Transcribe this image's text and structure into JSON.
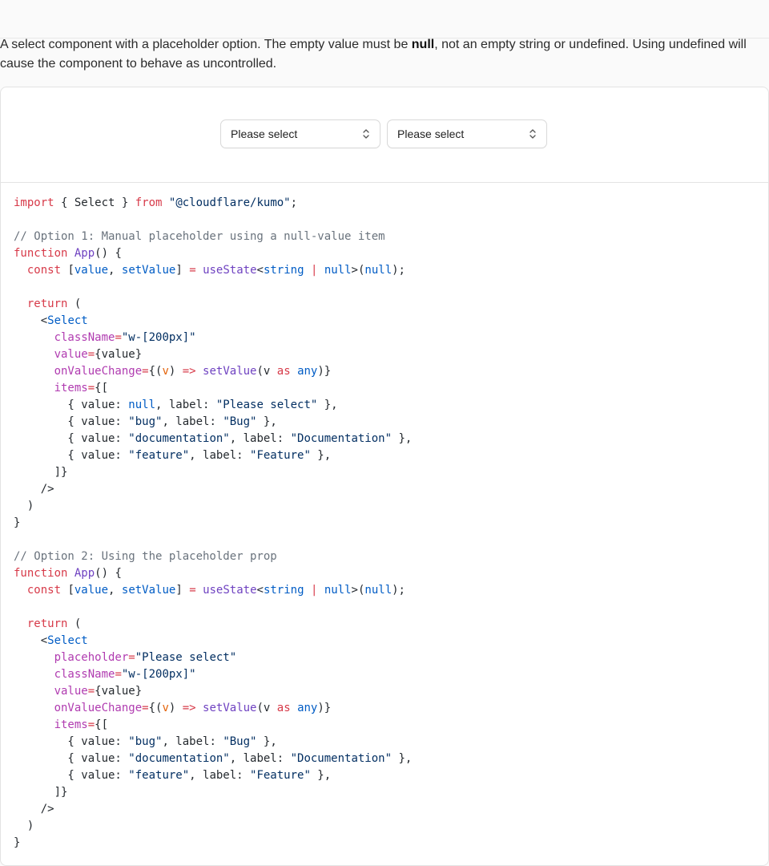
{
  "description": {
    "before": "A select component with a placeholder option. The empty value must be ",
    "bold": "null",
    "after": ", not an empty string or undefined. Using undefined will cause the component to behave as uncontrolled."
  },
  "preview": {
    "select1_value": "Please select",
    "select2_value": "Please select"
  },
  "code_lines": [
    [
      {
        "t": "import",
        "c": "kw"
      },
      {
        "t": " { Select } ",
        "c": "tx"
      },
      {
        "t": "from",
        "c": "kw"
      },
      {
        "t": " ",
        "c": "tx"
      },
      {
        "t": "\"@cloudflare/kumo\"",
        "c": "str"
      },
      {
        "t": ";",
        "c": "tx"
      }
    ],
    [],
    [
      {
        "t": "// Option 1: Manual placeholder using a null-value item",
        "c": "cm"
      }
    ],
    [
      {
        "t": "function",
        "c": "kw"
      },
      {
        "t": " ",
        "c": "tx"
      },
      {
        "t": "App",
        "c": "fn"
      },
      {
        "t": "() {",
        "c": "tx"
      }
    ],
    [
      {
        "t": "  const",
        "c": "kw"
      },
      {
        "t": " [",
        "c": "tx"
      },
      {
        "t": "value",
        "c": "bl"
      },
      {
        "t": ", ",
        "c": "tx"
      },
      {
        "t": "setValue",
        "c": "bl"
      },
      {
        "t": "] ",
        "c": "tx"
      },
      {
        "t": "=",
        "c": "kw"
      },
      {
        "t": " ",
        "c": "tx"
      },
      {
        "t": "useState",
        "c": "fn"
      },
      {
        "t": "<",
        "c": "tx"
      },
      {
        "t": "string",
        "c": "bl"
      },
      {
        "t": " ",
        "c": "tx"
      },
      {
        "t": "|",
        "c": "kw"
      },
      {
        "t": " ",
        "c": "tx"
      },
      {
        "t": "null",
        "c": "bl"
      },
      {
        "t": ">(",
        "c": "tx"
      },
      {
        "t": "null",
        "c": "bl"
      },
      {
        "t": ");",
        "c": "tx"
      }
    ],
    [],
    [
      {
        "t": "  return",
        "c": "kw"
      },
      {
        "t": " (",
        "c": "tx"
      }
    ],
    [
      {
        "t": "    <",
        "c": "tx"
      },
      {
        "t": "Select",
        "c": "bl"
      }
    ],
    [
      {
        "t": "      className",
        "c": "at"
      },
      {
        "t": "=",
        "c": "kw"
      },
      {
        "t": "\"w-[200px]\"",
        "c": "str"
      }
    ],
    [
      {
        "t": "      value",
        "c": "at"
      },
      {
        "t": "=",
        "c": "kw"
      },
      {
        "t": "{value}",
        "c": "tx"
      }
    ],
    [
      {
        "t": "      onValueChange",
        "c": "at"
      },
      {
        "t": "=",
        "c": "kw"
      },
      {
        "t": "{(",
        "c": "tx"
      },
      {
        "t": "v",
        "c": "or"
      },
      {
        "t": ") ",
        "c": "tx"
      },
      {
        "t": "=>",
        "c": "kw"
      },
      {
        "t": " ",
        "c": "tx"
      },
      {
        "t": "setValue",
        "c": "fn"
      },
      {
        "t": "(v ",
        "c": "tx"
      },
      {
        "t": "as",
        "c": "kw"
      },
      {
        "t": " ",
        "c": "tx"
      },
      {
        "t": "any",
        "c": "bl"
      },
      {
        "t": ")}",
        "c": "tx"
      }
    ],
    [
      {
        "t": "      items",
        "c": "at"
      },
      {
        "t": "=",
        "c": "kw"
      },
      {
        "t": "{[",
        "c": "tx"
      }
    ],
    [
      {
        "t": "        { value: ",
        "c": "tx"
      },
      {
        "t": "null",
        "c": "bl"
      },
      {
        "t": ", label: ",
        "c": "tx"
      },
      {
        "t": "\"Please select\"",
        "c": "str"
      },
      {
        "t": " },",
        "c": "tx"
      }
    ],
    [
      {
        "t": "        { value: ",
        "c": "tx"
      },
      {
        "t": "\"bug\"",
        "c": "str"
      },
      {
        "t": ", label: ",
        "c": "tx"
      },
      {
        "t": "\"Bug\"",
        "c": "str"
      },
      {
        "t": " },",
        "c": "tx"
      }
    ],
    [
      {
        "t": "        { value: ",
        "c": "tx"
      },
      {
        "t": "\"documentation\"",
        "c": "str"
      },
      {
        "t": ", label: ",
        "c": "tx"
      },
      {
        "t": "\"Documentation\"",
        "c": "str"
      },
      {
        "t": " },",
        "c": "tx"
      }
    ],
    [
      {
        "t": "        { value: ",
        "c": "tx"
      },
      {
        "t": "\"feature\"",
        "c": "str"
      },
      {
        "t": ", label: ",
        "c": "tx"
      },
      {
        "t": "\"Feature\"",
        "c": "str"
      },
      {
        "t": " },",
        "c": "tx"
      }
    ],
    [
      {
        "t": "      ]}",
        "c": "tx"
      }
    ],
    [
      {
        "t": "    />",
        "c": "tx"
      }
    ],
    [
      {
        "t": "  )",
        "c": "tx"
      }
    ],
    [
      {
        "t": "}",
        "c": "tx"
      }
    ],
    [],
    [
      {
        "t": "// Option 2: Using the placeholder prop",
        "c": "cm"
      }
    ],
    [
      {
        "t": "function",
        "c": "kw"
      },
      {
        "t": " ",
        "c": "tx"
      },
      {
        "t": "App",
        "c": "fn"
      },
      {
        "t": "() {",
        "c": "tx"
      }
    ],
    [
      {
        "t": "  const",
        "c": "kw"
      },
      {
        "t": " [",
        "c": "tx"
      },
      {
        "t": "value",
        "c": "bl"
      },
      {
        "t": ", ",
        "c": "tx"
      },
      {
        "t": "setValue",
        "c": "bl"
      },
      {
        "t": "] ",
        "c": "tx"
      },
      {
        "t": "=",
        "c": "kw"
      },
      {
        "t": " ",
        "c": "tx"
      },
      {
        "t": "useState",
        "c": "fn"
      },
      {
        "t": "<",
        "c": "tx"
      },
      {
        "t": "string",
        "c": "bl"
      },
      {
        "t": " ",
        "c": "tx"
      },
      {
        "t": "|",
        "c": "kw"
      },
      {
        "t": " ",
        "c": "tx"
      },
      {
        "t": "null",
        "c": "bl"
      },
      {
        "t": ">(",
        "c": "tx"
      },
      {
        "t": "null",
        "c": "bl"
      },
      {
        "t": ");",
        "c": "tx"
      }
    ],
    [],
    [
      {
        "t": "  return",
        "c": "kw"
      },
      {
        "t": " (",
        "c": "tx"
      }
    ],
    [
      {
        "t": "    <",
        "c": "tx"
      },
      {
        "t": "Select",
        "c": "bl"
      }
    ],
    [
      {
        "t": "      placeholder",
        "c": "at"
      },
      {
        "t": "=",
        "c": "kw"
      },
      {
        "t": "\"Please select\"",
        "c": "str"
      }
    ],
    [
      {
        "t": "      className",
        "c": "at"
      },
      {
        "t": "=",
        "c": "kw"
      },
      {
        "t": "\"w-[200px]\"",
        "c": "str"
      }
    ],
    [
      {
        "t": "      value",
        "c": "at"
      },
      {
        "t": "=",
        "c": "kw"
      },
      {
        "t": "{value}",
        "c": "tx"
      }
    ],
    [
      {
        "t": "      onValueChange",
        "c": "at"
      },
      {
        "t": "=",
        "c": "kw"
      },
      {
        "t": "{(",
        "c": "tx"
      },
      {
        "t": "v",
        "c": "or"
      },
      {
        "t": ") ",
        "c": "tx"
      },
      {
        "t": "=>",
        "c": "kw"
      },
      {
        "t": " ",
        "c": "tx"
      },
      {
        "t": "setValue",
        "c": "fn"
      },
      {
        "t": "(v ",
        "c": "tx"
      },
      {
        "t": "as",
        "c": "kw"
      },
      {
        "t": " ",
        "c": "tx"
      },
      {
        "t": "any",
        "c": "bl"
      },
      {
        "t": ")}",
        "c": "tx"
      }
    ],
    [
      {
        "t": "      items",
        "c": "at"
      },
      {
        "t": "=",
        "c": "kw"
      },
      {
        "t": "{[",
        "c": "tx"
      }
    ],
    [
      {
        "t": "        { value: ",
        "c": "tx"
      },
      {
        "t": "\"bug\"",
        "c": "str"
      },
      {
        "t": ", label: ",
        "c": "tx"
      },
      {
        "t": "\"Bug\"",
        "c": "str"
      },
      {
        "t": " },",
        "c": "tx"
      }
    ],
    [
      {
        "t": "        { value: ",
        "c": "tx"
      },
      {
        "t": "\"documentation\"",
        "c": "str"
      },
      {
        "t": ", label: ",
        "c": "tx"
      },
      {
        "t": "\"Documentation\"",
        "c": "str"
      },
      {
        "t": " },",
        "c": "tx"
      }
    ],
    [
      {
        "t": "        { value: ",
        "c": "tx"
      },
      {
        "t": "\"feature\"",
        "c": "str"
      },
      {
        "t": ", label: ",
        "c": "tx"
      },
      {
        "t": "\"Feature\"",
        "c": "str"
      },
      {
        "t": " },",
        "c": "tx"
      }
    ],
    [
      {
        "t": "      ]}",
        "c": "tx"
      }
    ],
    [
      {
        "t": "    />",
        "c": "tx"
      }
    ],
    [
      {
        "t": "  )",
        "c": "tx"
      }
    ],
    [
      {
        "t": "}",
        "c": "tx"
      }
    ]
  ]
}
